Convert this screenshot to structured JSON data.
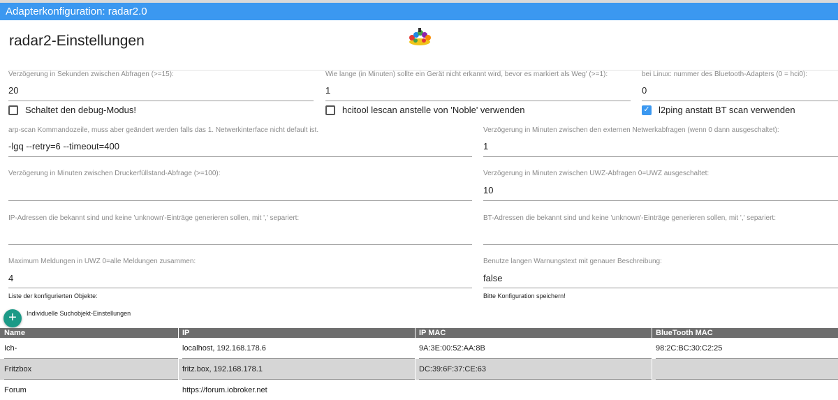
{
  "window": {
    "title": "Adapterkonfiguration: radar2.0"
  },
  "page": {
    "heading": "radar2-Einstellungen",
    "logo_icon": "radar2-logo-icon"
  },
  "fields": {
    "delay_seconds": {
      "label": "Verzögerung in Sekunden zwischen Abfragen (>=15):",
      "value": "20"
    },
    "not_found_minutes": {
      "label": "Wie lange (in Minuten) sollte ein Gerät nicht erkannt wird, bevor es markiert als Weg' (>=1):",
      "value": "1"
    },
    "bt_adapter": {
      "label": "bei Linux: nummer des Bluetooth-Adapters (0 = hci0):",
      "value": "0"
    },
    "arp_scan": {
      "label": "arp-scan Kommandozeile, muss aber geändert werden falls das 1. Netwerkinterface nicht default ist.",
      "value": "-lgq --retry=6 --timeout=400"
    },
    "ext_net_delay": {
      "label": "Verzögerung in Minuten zwischen den externen Netwerkabfragen (wenn 0 dann ausgeschaltet):",
      "value": "1"
    },
    "printer_delay": {
      "label": "Verzögerung in Minuten zwischen Druckerfüllstand-Abfrage (>=100):",
      "value": ""
    },
    "uwz_delay": {
      "label": "Verzögerung in Minuten zwischen UWZ-Abfragen 0=UWZ ausgeschaltet:",
      "value": "10"
    },
    "known_ips": {
      "label": "IP-Adressen die bekannt sind und keine 'unknown'-Einträge generieren sollen, mit ',' separiert:",
      "value": ""
    },
    "known_bt": {
      "label": "BT-Adressen die bekannt sind und keine 'unknown'-Einträge generieren sollen, mit ',' separiert:",
      "value": ""
    },
    "max_uwz": {
      "label": "Maximum Meldungen in UWZ 0=alle Meldungen zusammen:",
      "value": "4"
    },
    "long_warning": {
      "label": "Benutze langen Warnungstext mit genauer Beschreibung:",
      "value": "false"
    }
  },
  "checkboxes": {
    "debug": {
      "label": "Schaltet den debug-Modus!",
      "checked": false
    },
    "hcitool": {
      "label": "hcitool lescan anstelle von 'Noble' verwenden",
      "checked": false
    },
    "l2ping": {
      "label": "l2ping anstatt BT scan verwenden",
      "checked": true,
      "check_glyph": "✓"
    }
  },
  "notes": {
    "objects_list": "Liste der konfigurierten Objekte:",
    "save_hint": "Bitte Konfiguration speichern!"
  },
  "add_object": {
    "icon": "plus-icon",
    "glyph": "+",
    "label": "Individuelle Suchobjekt-Einstellungen"
  },
  "table": {
    "columns": [
      "Name",
      "IP",
      "IP MAC",
      "BlueTooth MAC"
    ],
    "rows": [
      {
        "name": "Ich-",
        "ip": "localhost, 192.168.178.6",
        "ip_mac": "9A:3E:00:52:AA:8B",
        "bt_mac": "98:2C:BC:30:C2:25"
      },
      {
        "name": "Fritzbox",
        "ip": "fritz.box, 192.168.178.1",
        "ip_mac": "DC:39:6F:37:CE:63",
        "bt_mac": ""
      },
      {
        "name": "Forum",
        "ip": "https://forum.iobroker.net",
        "ip_mac": "",
        "bt_mac": ""
      }
    ]
  },
  "colors": {
    "titlebar": "#3b98f0",
    "add_button": "#1b9a87",
    "table_header": "#6d6d6d",
    "alt_row": "#d6d6d6"
  }
}
